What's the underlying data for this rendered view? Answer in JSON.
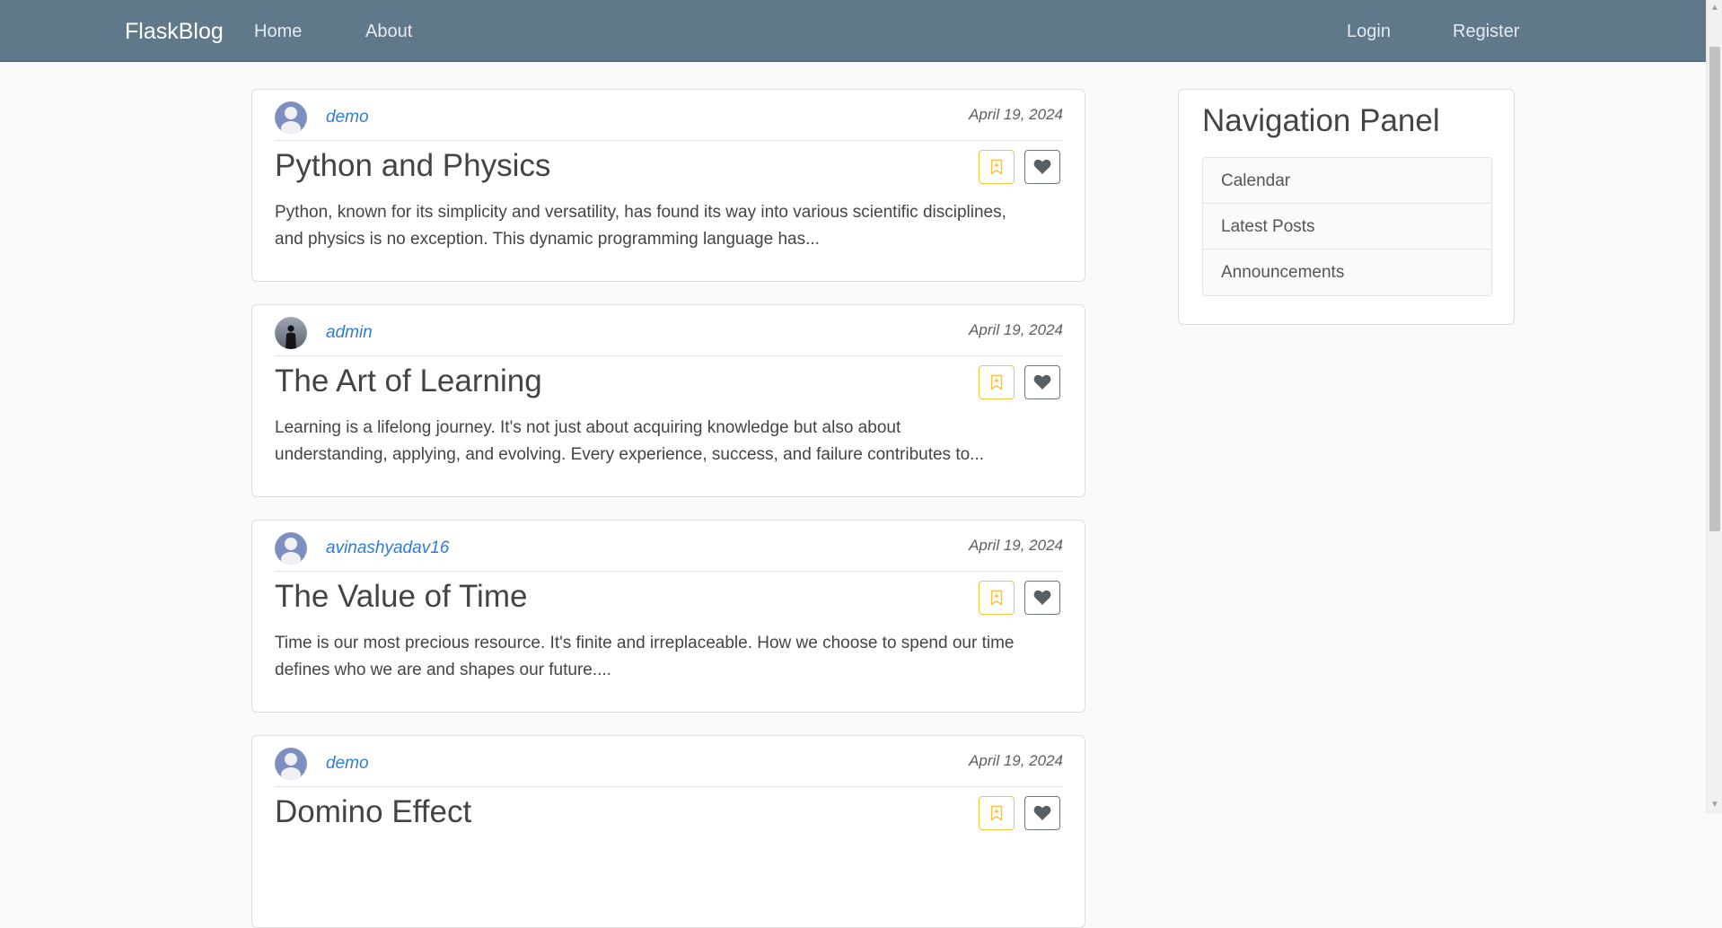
{
  "navbar": {
    "brand": "FlaskBlog",
    "links": [
      "Home",
      "About"
    ],
    "auth_links": [
      "Login",
      "Register"
    ],
    "background": "#5f788a"
  },
  "posts": [
    {
      "author": "demo",
      "date": "April 19, 2024",
      "title": "Python and Physics",
      "excerpt_line1": "Python, known for its simplicity and versatility, has found its way into various scientific disciplines,",
      "excerpt_line2": "and physics is no exception. This dynamic programming language has...",
      "avatar": "default-user-icon"
    },
    {
      "author": "admin",
      "date": "April 19, 2024",
      "title": "The Art of Learning",
      "excerpt_line1": "Learning is a lifelong journey. It's not just about acquiring knowledge but also about",
      "excerpt_line2": "understanding, applying, and evolving. Every experience, success, and failure contributes to...",
      "avatar": "photo-silhouette"
    },
    {
      "author": "avinashyadav16",
      "date": "April 19, 2024",
      "title": "The Value of Time",
      "excerpt_line1": "Time is our most precious resource. It's finite and irreplaceable. How we choose to spend our time",
      "excerpt_line2": "defines who we are and shapes our future....",
      "avatar": "default-user-icon"
    },
    {
      "author": "demo",
      "date": "April 19, 2024",
      "title": "Domino Effect",
      "avatar": "default-user-icon"
    }
  ],
  "side_panel": {
    "title": "Navigation Panel",
    "items": [
      "Calendar",
      "Latest Posts",
      "Announcements"
    ]
  },
  "colors": {
    "accent_link": "#2f7bd9",
    "bookmark_border": "#f5c242",
    "like_border": "#6c757d"
  }
}
